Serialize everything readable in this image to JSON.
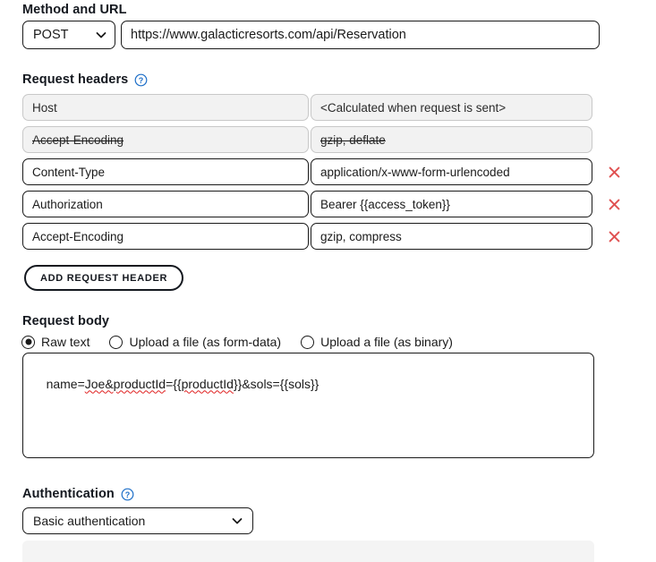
{
  "method_url": {
    "label": "Method and URL",
    "method": "POST",
    "url": "https://www.galacticresorts.com/api/Reservation"
  },
  "request_headers": {
    "label": "Request headers",
    "help_icon": "help-circle-icon",
    "rows": [
      {
        "name": "Host",
        "value": "<Calculated when request is sent>",
        "disabled": true,
        "struck": false,
        "removable": false
      },
      {
        "name": "Accept-Encoding",
        "value": "gzip, deflate",
        "disabled": true,
        "struck": true,
        "removable": false
      },
      {
        "name": "Content-Type",
        "value": "application/x-www-form-urlencoded",
        "disabled": false,
        "struck": false,
        "removable": true
      },
      {
        "name": "Authorization",
        "value": "Bearer {{access_token}}",
        "disabled": false,
        "struck": false,
        "removable": true
      },
      {
        "name": "Accept-Encoding",
        "value": "gzip, compress",
        "disabled": false,
        "struck": false,
        "removable": true
      }
    ],
    "add_button_label": "ADD REQUEST HEADER",
    "remove_icon": "close-x-icon"
  },
  "request_body": {
    "label": "Request body",
    "options": [
      {
        "label": "Raw text",
        "selected": true
      },
      {
        "label": "Upload a file (as form-data)",
        "selected": false
      },
      {
        "label": "Upload a file (as binary)",
        "selected": false
      }
    ],
    "text_segments": [
      {
        "text": "name=",
        "misspelled": false
      },
      {
        "text": "Joe&productId",
        "misspelled": true
      },
      {
        "text": "={{",
        "misspelled": false
      },
      {
        "text": "productId",
        "misspelled": true
      },
      {
        "text": "}}&sols={{sols}}",
        "misspelled": false
      }
    ],
    "text": "name=Joe&productId={{productId}}&sols={{sols}}",
    "resize_handle": "resize-grip-icon"
  },
  "authentication": {
    "label": "Authentication",
    "help_icon": "help-circle-icon",
    "selected": "Basic authentication"
  },
  "colors": {
    "text": "#1a1a1a",
    "heading": "#14181f",
    "border": "#1a1a1a",
    "disabled_bg": "#f2f2f2",
    "disabled_border": "#c8c8c8",
    "remove_red": "#e05252",
    "help_blue": "#1c6ec8",
    "spell_red": "#e02020",
    "panel_bg": "#f4f4f4"
  }
}
